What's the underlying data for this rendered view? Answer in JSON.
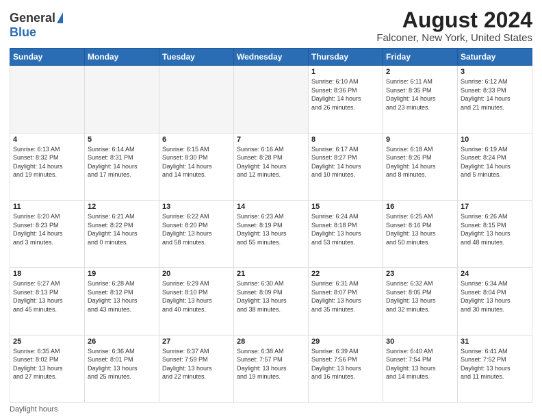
{
  "header": {
    "logo_general": "General",
    "logo_blue": "Blue",
    "title": "August 2024",
    "subtitle": "Falconer, New York, United States"
  },
  "weekdays": [
    "Sunday",
    "Monday",
    "Tuesday",
    "Wednesday",
    "Thursday",
    "Friday",
    "Saturday"
  ],
  "weeks": [
    [
      {
        "day": "",
        "info": ""
      },
      {
        "day": "",
        "info": ""
      },
      {
        "day": "",
        "info": ""
      },
      {
        "day": "",
        "info": ""
      },
      {
        "day": "1",
        "info": "Sunrise: 6:10 AM\nSunset: 8:36 PM\nDaylight: 14 hours\nand 26 minutes."
      },
      {
        "day": "2",
        "info": "Sunrise: 6:11 AM\nSunset: 8:35 PM\nDaylight: 14 hours\nand 23 minutes."
      },
      {
        "day": "3",
        "info": "Sunrise: 6:12 AM\nSunset: 8:33 PM\nDaylight: 14 hours\nand 21 minutes."
      }
    ],
    [
      {
        "day": "4",
        "info": "Sunrise: 6:13 AM\nSunset: 8:32 PM\nDaylight: 14 hours\nand 19 minutes."
      },
      {
        "day": "5",
        "info": "Sunrise: 6:14 AM\nSunset: 8:31 PM\nDaylight: 14 hours\nand 17 minutes."
      },
      {
        "day": "6",
        "info": "Sunrise: 6:15 AM\nSunset: 8:30 PM\nDaylight: 14 hours\nand 14 minutes."
      },
      {
        "day": "7",
        "info": "Sunrise: 6:16 AM\nSunset: 8:28 PM\nDaylight: 14 hours\nand 12 minutes."
      },
      {
        "day": "8",
        "info": "Sunrise: 6:17 AM\nSunset: 8:27 PM\nDaylight: 14 hours\nand 10 minutes."
      },
      {
        "day": "9",
        "info": "Sunrise: 6:18 AM\nSunset: 8:26 PM\nDaylight: 14 hours\nand 8 minutes."
      },
      {
        "day": "10",
        "info": "Sunrise: 6:19 AM\nSunset: 8:24 PM\nDaylight: 14 hours\nand 5 minutes."
      }
    ],
    [
      {
        "day": "11",
        "info": "Sunrise: 6:20 AM\nSunset: 8:23 PM\nDaylight: 14 hours\nand 3 minutes."
      },
      {
        "day": "12",
        "info": "Sunrise: 6:21 AM\nSunset: 8:22 PM\nDaylight: 14 hours\nand 0 minutes."
      },
      {
        "day": "13",
        "info": "Sunrise: 6:22 AM\nSunset: 8:20 PM\nDaylight: 13 hours\nand 58 minutes."
      },
      {
        "day": "14",
        "info": "Sunrise: 6:23 AM\nSunset: 8:19 PM\nDaylight: 13 hours\nand 55 minutes."
      },
      {
        "day": "15",
        "info": "Sunrise: 6:24 AM\nSunset: 8:18 PM\nDaylight: 13 hours\nand 53 minutes."
      },
      {
        "day": "16",
        "info": "Sunrise: 6:25 AM\nSunset: 8:16 PM\nDaylight: 13 hours\nand 50 minutes."
      },
      {
        "day": "17",
        "info": "Sunrise: 6:26 AM\nSunset: 8:15 PM\nDaylight: 13 hours\nand 48 minutes."
      }
    ],
    [
      {
        "day": "18",
        "info": "Sunrise: 6:27 AM\nSunset: 8:13 PM\nDaylight: 13 hours\nand 45 minutes."
      },
      {
        "day": "19",
        "info": "Sunrise: 6:28 AM\nSunset: 8:12 PM\nDaylight: 13 hours\nand 43 minutes."
      },
      {
        "day": "20",
        "info": "Sunrise: 6:29 AM\nSunset: 8:10 PM\nDaylight: 13 hours\nand 40 minutes."
      },
      {
        "day": "21",
        "info": "Sunrise: 6:30 AM\nSunset: 8:09 PM\nDaylight: 13 hours\nand 38 minutes."
      },
      {
        "day": "22",
        "info": "Sunrise: 6:31 AM\nSunset: 8:07 PM\nDaylight: 13 hours\nand 35 minutes."
      },
      {
        "day": "23",
        "info": "Sunrise: 6:32 AM\nSunset: 8:05 PM\nDaylight: 13 hours\nand 32 minutes."
      },
      {
        "day": "24",
        "info": "Sunrise: 6:34 AM\nSunset: 8:04 PM\nDaylight: 13 hours\nand 30 minutes."
      }
    ],
    [
      {
        "day": "25",
        "info": "Sunrise: 6:35 AM\nSunset: 8:02 PM\nDaylight: 13 hours\nand 27 minutes."
      },
      {
        "day": "26",
        "info": "Sunrise: 6:36 AM\nSunset: 8:01 PM\nDaylight: 13 hours\nand 25 minutes."
      },
      {
        "day": "27",
        "info": "Sunrise: 6:37 AM\nSunset: 7:59 PM\nDaylight: 13 hours\nand 22 minutes."
      },
      {
        "day": "28",
        "info": "Sunrise: 6:38 AM\nSunset: 7:57 PM\nDaylight: 13 hours\nand 19 minutes."
      },
      {
        "day": "29",
        "info": "Sunrise: 6:39 AM\nSunset: 7:56 PM\nDaylight: 13 hours\nand 16 minutes."
      },
      {
        "day": "30",
        "info": "Sunrise: 6:40 AM\nSunset: 7:54 PM\nDaylight: 13 hours\nand 14 minutes."
      },
      {
        "day": "31",
        "info": "Sunrise: 6:41 AM\nSunset: 7:52 PM\nDaylight: 13 hours\nand 11 minutes."
      }
    ]
  ],
  "footer": {
    "daylight_label": "Daylight hours"
  }
}
